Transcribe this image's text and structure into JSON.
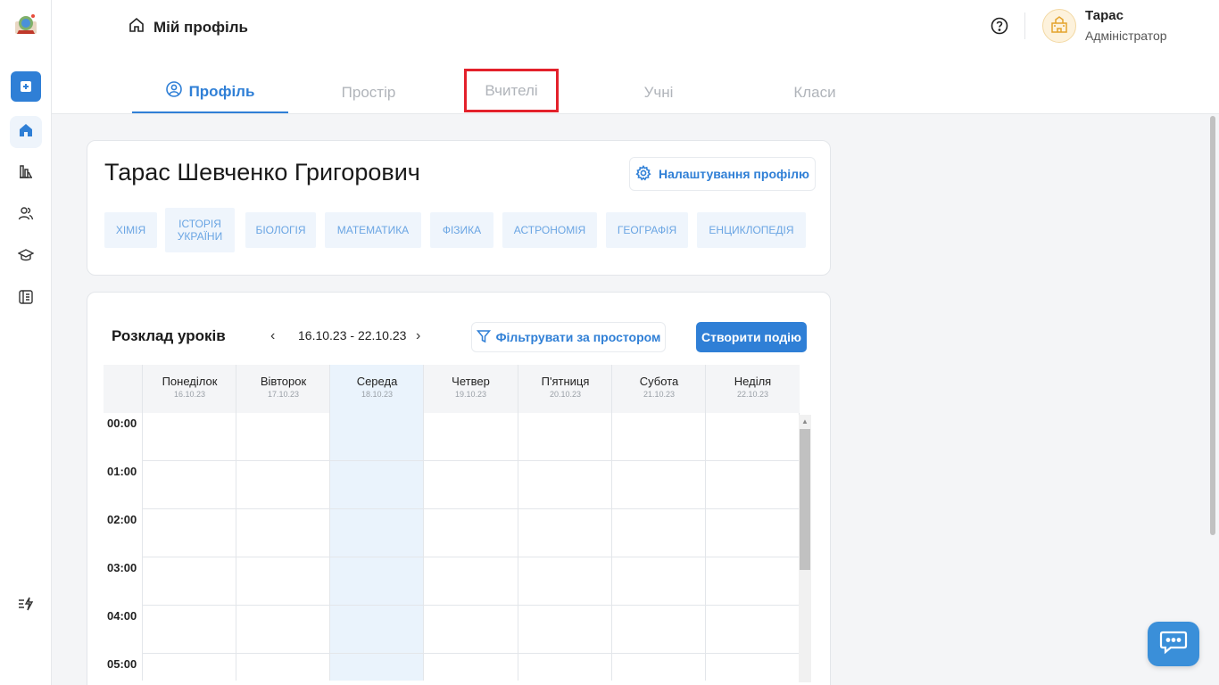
{
  "sidebar": {
    "logo": "school-logo",
    "items": [
      {
        "name": "add",
        "icon": "plus-square-icon"
      },
      {
        "name": "home",
        "icon": "home-icon"
      },
      {
        "name": "stats",
        "icon": "bar-chart-icon"
      },
      {
        "name": "users",
        "icon": "users-icon"
      },
      {
        "name": "education",
        "icon": "graduation-cap-icon"
      },
      {
        "name": "journal",
        "icon": "notebook-icon"
      },
      {
        "name": "automation",
        "icon": "lightning-list-icon"
      }
    ]
  },
  "header": {
    "title": "Мій профіль",
    "user": {
      "name": "Тарас",
      "role": "Адміністратор"
    }
  },
  "tabs": [
    {
      "label": "Профіль",
      "active": true
    },
    {
      "label": "Простір",
      "active": false
    },
    {
      "label": "Вчителі",
      "active": false,
      "highlighted": true
    },
    {
      "label": "Учні",
      "active": false
    },
    {
      "label": "Класи",
      "active": false
    }
  ],
  "profile": {
    "full_name": "Тарас Шевченко Григорович",
    "settings_label": "Налаштування профілю",
    "subjects": [
      "Хімія",
      "Історія України",
      "Біологія",
      "Математика",
      "Фізика",
      "Астрономія",
      "Географія",
      "Енциклопедія"
    ]
  },
  "schedule": {
    "title": "Розклад уроків",
    "week_range": "16.10.23 - 22.10.23",
    "prev": "‹",
    "next": "›",
    "filter_label": "Фільтрувати за простором",
    "create_label": "Створити подію",
    "days": [
      {
        "name": "Понеділок",
        "date": "16.10.23"
      },
      {
        "name": "Вівторок",
        "date": "17.10.23"
      },
      {
        "name": "Середа",
        "date": "18.10.23",
        "today": true
      },
      {
        "name": "Четвер",
        "date": "19.10.23"
      },
      {
        "name": "П'ятниця",
        "date": "20.10.23"
      },
      {
        "name": "Субота",
        "date": "21.10.23"
      },
      {
        "name": "Неділя",
        "date": "22.10.23"
      }
    ],
    "times": [
      "00:00",
      "01:00",
      "02:00",
      "03:00",
      "04:00",
      "05:00"
    ]
  },
  "colors": {
    "accent": "#2f7fd6",
    "highlight": "#e3212b",
    "today": "#eaf3fc"
  }
}
